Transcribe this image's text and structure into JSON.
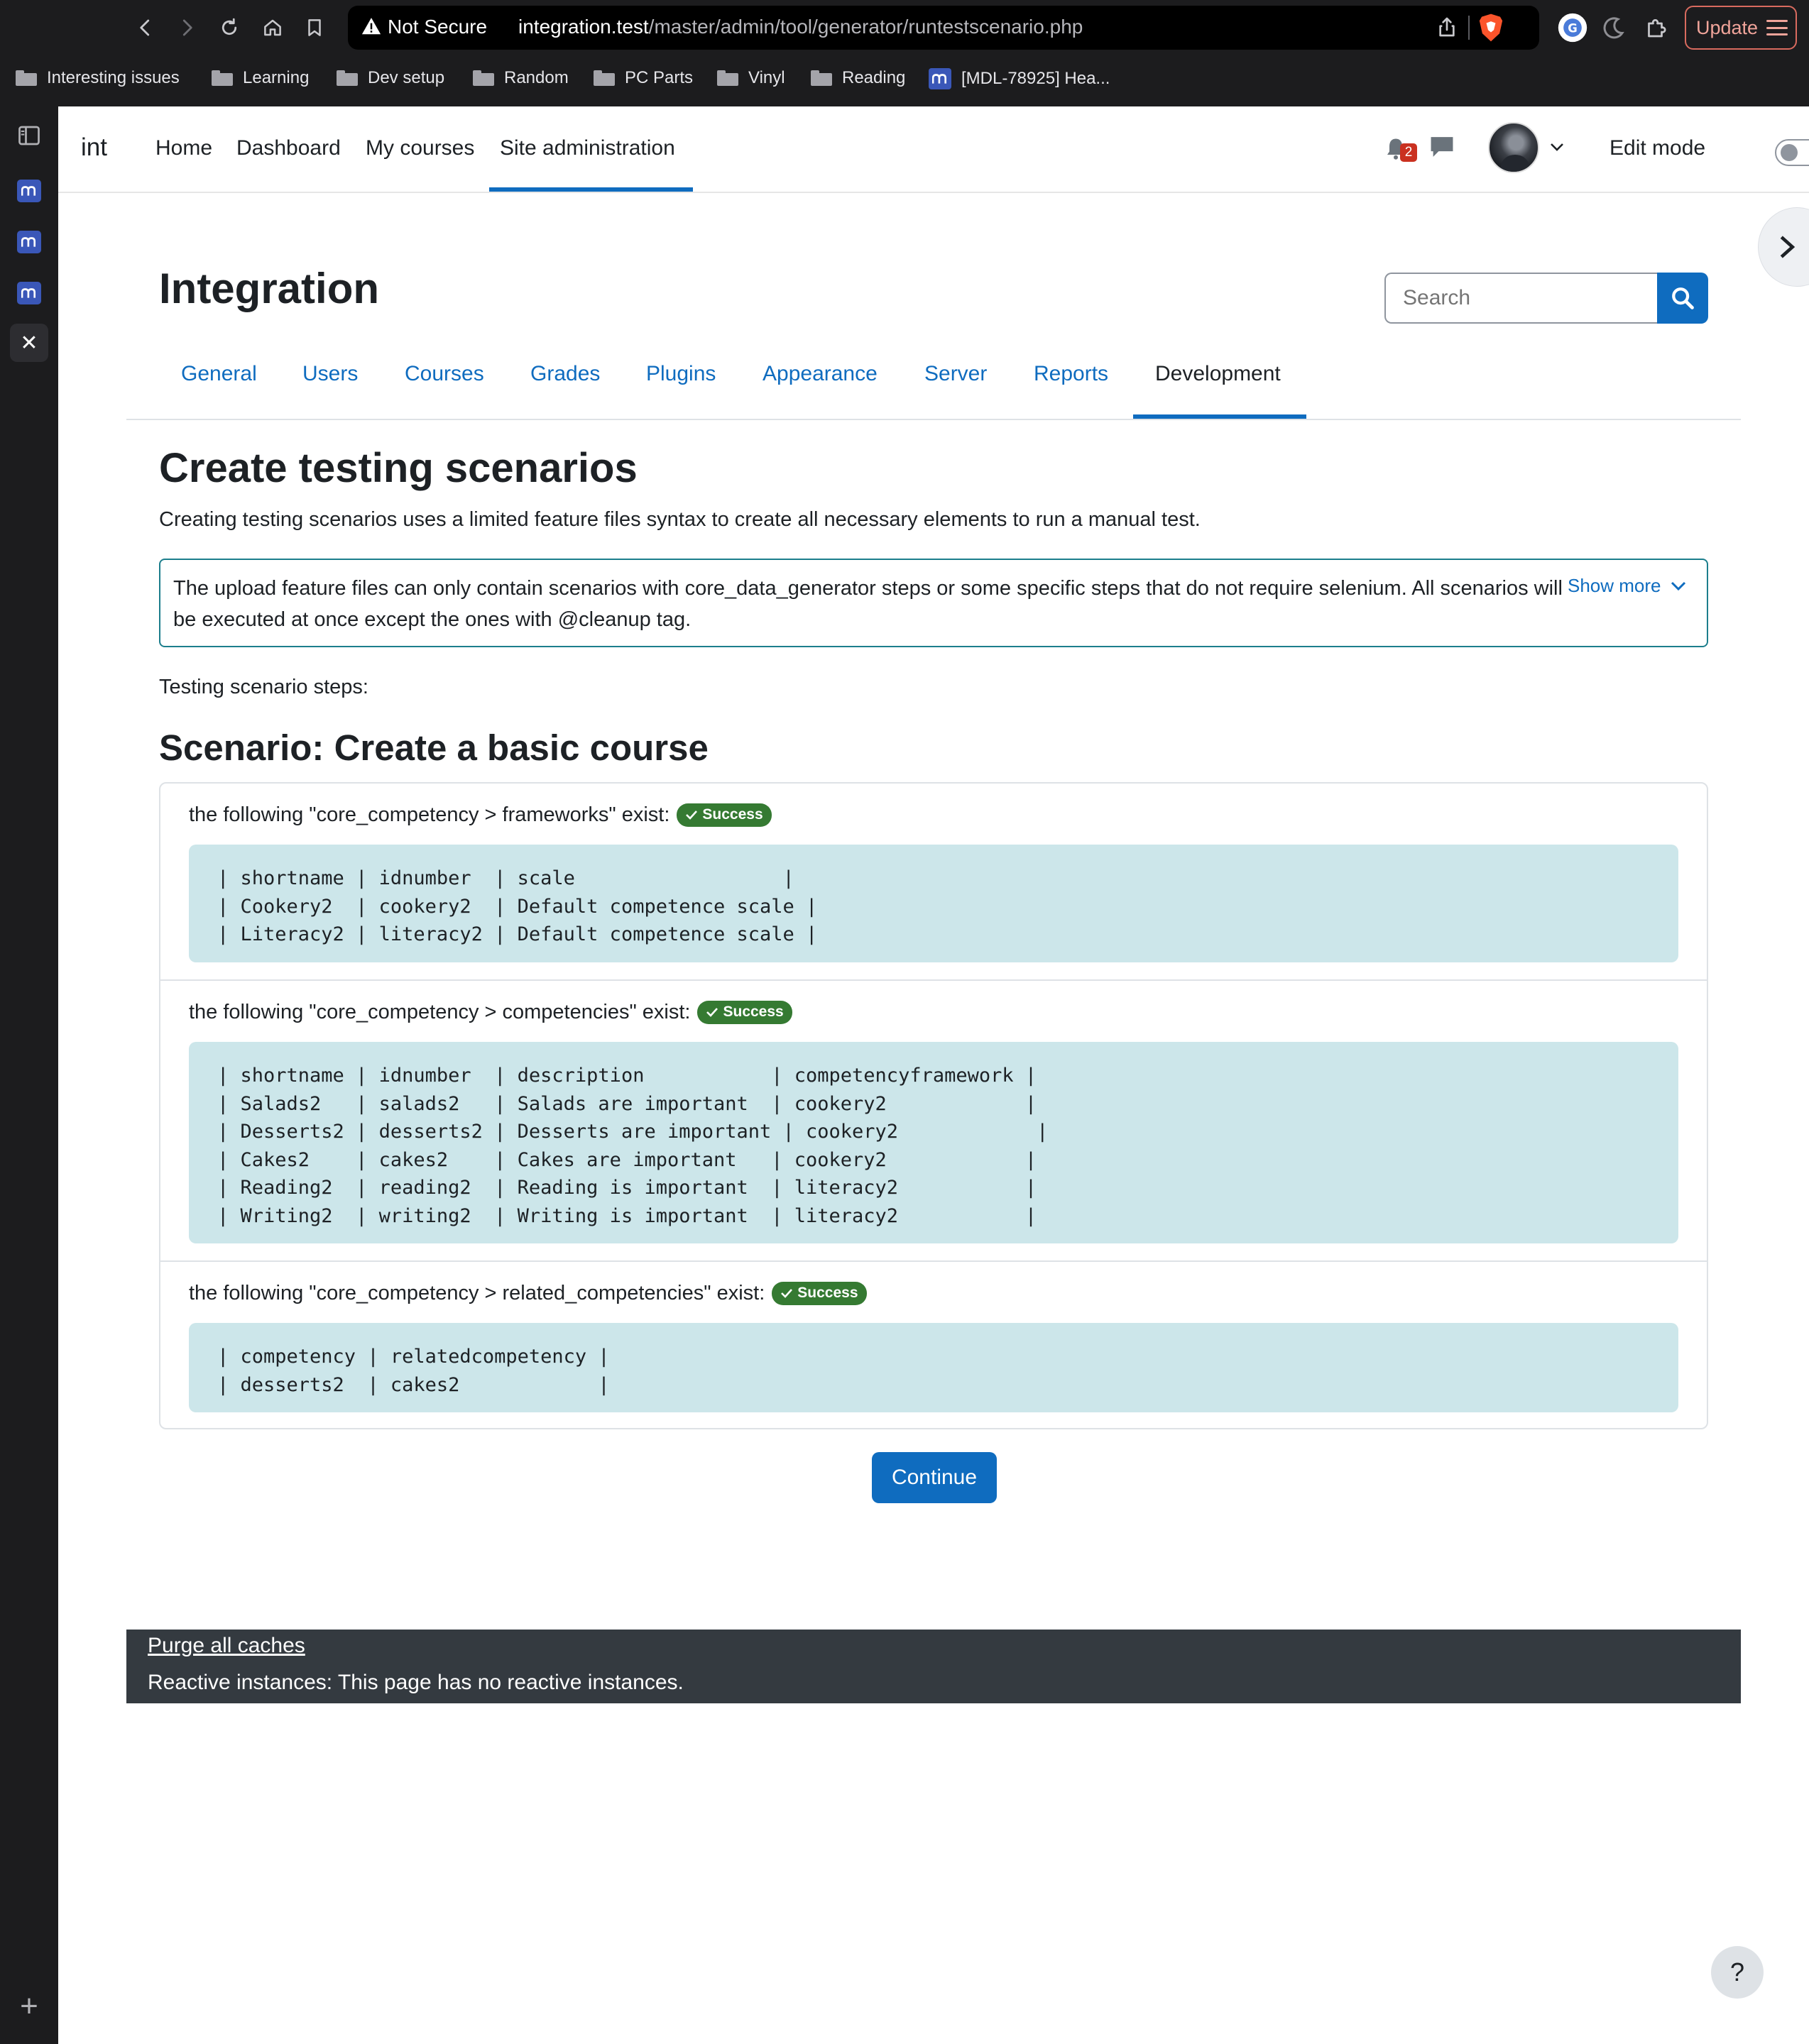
{
  "browser": {
    "security_label": "Not Secure",
    "url_host": "integration.test",
    "url_path": "/master/admin/tool/generator/runtestscenario.php",
    "update_label": "Update",
    "bookmarks": [
      {
        "label": "Interesting issues",
        "icon": "folder-icon"
      },
      {
        "label": "Learning",
        "icon": "folder-icon"
      },
      {
        "label": "Dev setup",
        "icon": "folder-icon"
      },
      {
        "label": "Random",
        "icon": "folder-icon"
      },
      {
        "label": "PC Parts",
        "icon": "folder-icon"
      },
      {
        "label": "Vinyl",
        "icon": "folder-icon"
      },
      {
        "label": "Reading",
        "icon": "folder-icon"
      },
      {
        "label": "[MDL-78925] Hea...",
        "icon": "moodle-icon"
      }
    ]
  },
  "navbar": {
    "brand": "int",
    "links": [
      "Home",
      "Dashboard",
      "My courses",
      "Site administration"
    ],
    "active_link": "Site administration",
    "notification_count": "2",
    "edit_mode_label": "Edit mode",
    "edit_mode_on": false
  },
  "header": {
    "title": "Integration",
    "search_placeholder": "Search"
  },
  "tabs": [
    "General",
    "Users",
    "Courses",
    "Grades",
    "Plugins",
    "Appearance",
    "Server",
    "Reports",
    "Development"
  ],
  "active_tab": "Development",
  "content": {
    "heading": "Create testing scenarios",
    "intro": "Creating testing scenarios uses a limited feature files syntax to create all necessary elements to run a manual test.",
    "info": "The upload feature files can only contain scenarios with core_data_generator steps or some specific steps that do not require selenium. All scenarios will be executed at once except the ones with @cleanup tag.",
    "show_more": "Show more",
    "steps_label": "Testing scenario steps:",
    "scenario_title": "Scenario: Create a basic course",
    "steps": [
      {
        "title": "the following \"core_competency > frameworks\" exist:",
        "status": "Success",
        "lines": [
          "| shortname | idnumber  | scale                  |",
          "| Cookery2  | cookery2  | Default competence scale |",
          "| Literacy2 | literacy2 | Default competence scale |"
        ]
      },
      {
        "title": "the following \"core_competency > competencies\" exist:",
        "status": "Success",
        "lines": [
          "| shortname | idnumber  | description           | competencyframework |",
          "| Salads2   | salads2   | Salads are important  | cookery2            |",
          "| Desserts2 | desserts2 | Desserts are important | cookery2            |",
          "| Cakes2    | cakes2    | Cakes are important   | cookery2            |",
          "| Reading2  | reading2  | Reading is important  | literacy2           |",
          "| Writing2  | writing2  | Writing is important  | literacy2           |"
        ]
      },
      {
        "title": "the following \"core_competency > related_competencies\" exist:",
        "status": "Success",
        "lines": [
          "| competency | relatedcompetency |",
          "| desserts2  | cakes2            |"
        ]
      }
    ],
    "continue_label": "Continue"
  },
  "footer": {
    "purge_link": "Purge all caches",
    "reactive_text": "Reactive instances: This page has no reactive instances."
  },
  "help_label": "?",
  "colors": {
    "primary": "#0f6cbf",
    "success": "#357a32",
    "info_border": "#1c7e8c",
    "code_bg": "#cce6ea",
    "footer_bg": "#343a40"
  }
}
